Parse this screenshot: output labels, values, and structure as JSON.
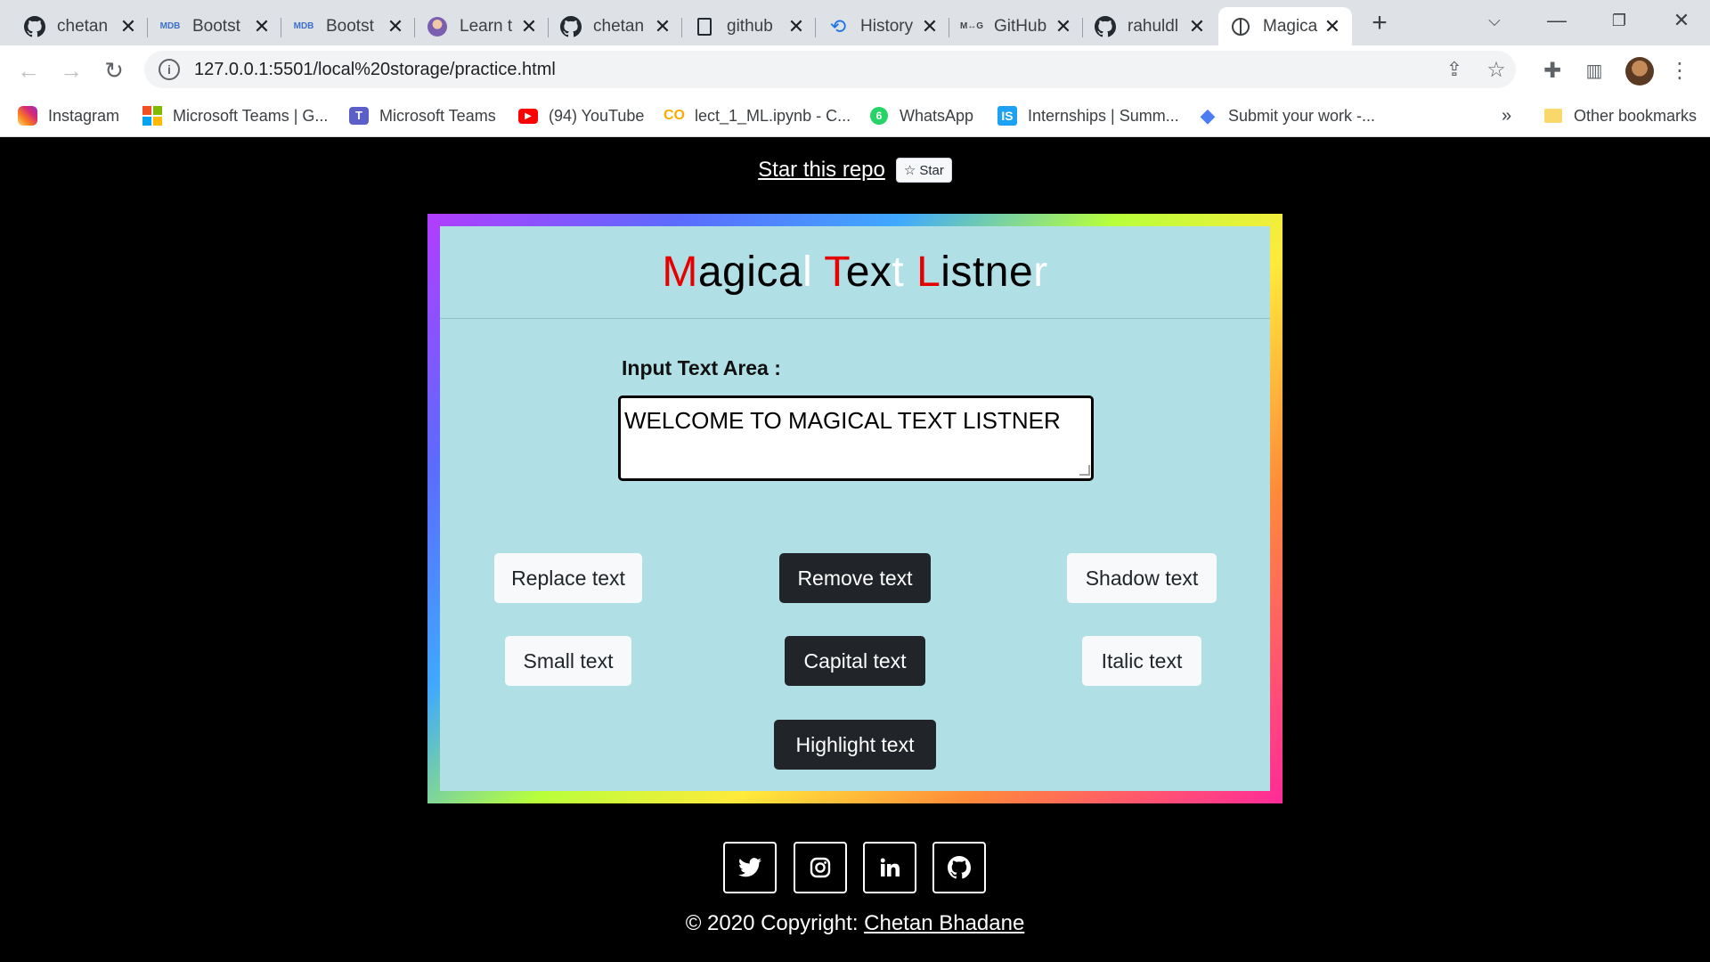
{
  "browser": {
    "tabs": [
      {
        "title": "chetan",
        "icon": "github-icon"
      },
      {
        "title": "Bootst",
        "icon": "mdb-icon"
      },
      {
        "title": "Bootst",
        "icon": "mdb-icon"
      },
      {
        "title": "Learn t",
        "icon": "avatar-icon"
      },
      {
        "title": "chetan",
        "icon": "github-icon"
      },
      {
        "title": "github",
        "icon": "book-icon"
      },
      {
        "title": "History",
        "icon": "history-icon"
      },
      {
        "title": "GitHub",
        "icon": "mg-icon"
      },
      {
        "title": "rahuldl",
        "icon": "github-icon"
      },
      {
        "title": "Magica",
        "icon": "globe-icon",
        "active": true
      }
    ],
    "url": "127.0.0.1:5501/local%20storage/practice.html",
    "bookmarks": [
      {
        "label": "Instagram",
        "icon": "instagram-icon"
      },
      {
        "label": "Microsoft Teams | G...",
        "icon": "microsoft-icon"
      },
      {
        "label": "Microsoft Teams",
        "icon": "teams-icon"
      },
      {
        "label": "(94) YouTube",
        "icon": "youtube-icon"
      },
      {
        "label": "lect_1_ML.ipynb - C...",
        "icon": "colab-icon"
      },
      {
        "label": "WhatsApp",
        "icon": "whatsapp-icon"
      },
      {
        "label": "Internships | Summ...",
        "icon": "internshala-icon"
      },
      {
        "label": "Submit your work -...",
        "icon": "diamond-icon"
      }
    ],
    "bookmarks_more": "»",
    "other_bookmarks": "Other bookmarks"
  },
  "page": {
    "star_link": "Star this repo",
    "star_button": "Star",
    "title_parts": [
      {
        "text": "M",
        "color": "red"
      },
      {
        "text": "agica",
        "color": "black"
      },
      {
        "text": "l ",
        "color": "white"
      },
      {
        "text": "T",
        "color": "red"
      },
      {
        "text": "ex",
        "color": "black"
      },
      {
        "text": "t ",
        "color": "white"
      },
      {
        "text": "L",
        "color": "red"
      },
      {
        "text": "istne",
        "color": "black"
      },
      {
        "text": "r",
        "color": "white"
      }
    ],
    "input_label": "Input Text Area :",
    "textarea_value": "WELCOME TO MAGICAL TEXT LISTNER",
    "buttons": {
      "replace": "Replace text",
      "remove": "Remove text",
      "shadow": "Shadow text",
      "small": "Small text",
      "capital": "Capital text",
      "italic": "Italic text",
      "highlight": "Highlight text"
    },
    "social": [
      "twitter-icon",
      "instagram-icon",
      "linkedin-icon",
      "github-icon"
    ],
    "footer_prefix": "© 2020 Copyright: ",
    "footer_link": "Chetan Bhadane"
  },
  "colors": {
    "card_bg": "#b0dfe5",
    "title_red": "#e60000",
    "dark_button": "#212529",
    "light_button": "#f8f9fa",
    "page_bg": "#000000"
  }
}
